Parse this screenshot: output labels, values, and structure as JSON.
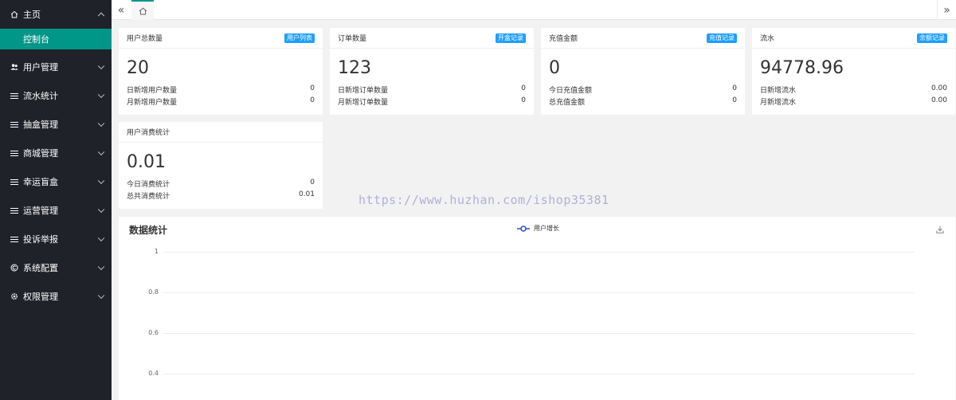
{
  "sidebar": {
    "home": "主页",
    "sub_active": "控制台",
    "items": [
      {
        "label": "用户管理",
        "icon": "users-icon"
      },
      {
        "label": "流水统计",
        "icon": "list-icon"
      },
      {
        "label": "抽盒管理",
        "icon": "list-icon"
      },
      {
        "label": "商城管理",
        "icon": "list-icon"
      },
      {
        "label": "幸运盲盒",
        "icon": "list-icon"
      },
      {
        "label": "运营管理",
        "icon": "list-icon"
      },
      {
        "label": "投诉举报",
        "icon": "list-icon"
      },
      {
        "label": "系统配置",
        "icon": "copyright-icon"
      },
      {
        "label": "权限管理",
        "icon": "gear-icon"
      }
    ]
  },
  "topbar": {
    "left_glyph": "«",
    "right_glyph": "»"
  },
  "cards": [
    {
      "title": "用户总数量",
      "badge": "用户列表",
      "value": "20",
      "rows": [
        {
          "label": "日新增用户数量",
          "value": "0"
        },
        {
          "label": "月新增用户数量",
          "value": "0"
        }
      ]
    },
    {
      "title": "订单数量",
      "badge": "开盒记录",
      "value": "123",
      "rows": [
        {
          "label": "日新增订单数量",
          "value": "0"
        },
        {
          "label": "月新增订单数量",
          "value": "0"
        }
      ]
    },
    {
      "title": "充值金额",
      "badge": "充值记录",
      "value": "0",
      "rows": [
        {
          "label": "今日充值金额",
          "value": "0"
        },
        {
          "label": "总充值金额",
          "value": "0"
        }
      ]
    },
    {
      "title": "流水",
      "badge": "余额记录",
      "value": "94778.96",
      "rows": [
        {
          "label": "日新增流水",
          "value": "0.00"
        },
        {
          "label": "月新增流水",
          "value": "0.00"
        }
      ]
    },
    {
      "title": "用户消费统计",
      "value": "0.01",
      "rows": [
        {
          "label": "今日消费统计",
          "value": "0"
        },
        {
          "label": "总共消费统计",
          "value": "0.01"
        }
      ]
    }
  ],
  "chart_panel": {
    "title": "数据统计",
    "legend": "用户增长",
    "accent": "#2f4fc2",
    "y_ticks": [
      "1",
      "0.8",
      "0.6",
      "0.4"
    ]
  },
  "watermark": "https://www.huzhan.com/ishop35381",
  "colors": {
    "sidebar": "#20222a",
    "active": "#009688",
    "badge": "#1e9fff"
  }
}
